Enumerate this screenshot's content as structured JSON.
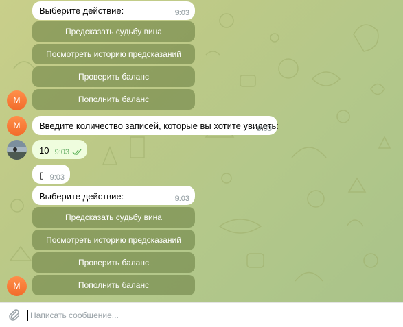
{
  "chat": {
    "background_colors": [
      "#c9cf8a",
      "#a9c38a"
    ],
    "messages": [
      {
        "text": "Выберите действие:",
        "time": "9:03"
      },
      {
        "text": "Введите количество записей, которые вы хотите увидеть:",
        "time": "9:03"
      },
      {
        "text": "10",
        "time": "9:03",
        "status": "read"
      },
      {
        "text": "▯",
        "time": "9:03"
      },
      {
        "text": "Выберите действие:",
        "time": "9:03"
      }
    ],
    "keyboard1": [
      "Предсказать судьбу вина",
      "Посмотреть историю предсказаний",
      "Проверить баланс",
      "Пополнить баланс"
    ],
    "keyboard2": [
      "Предсказать судьбу вина",
      "Посмотреть историю предсказаний",
      "Проверить баланс",
      "Пополнить баланс"
    ],
    "avatar_letter": "M",
    "avatar_color": "#f2782f",
    "read_check_color": "#5fb35a"
  },
  "input": {
    "placeholder": "Написать сообщение...",
    "value": ""
  },
  "icons": {
    "attach": "paperclip-icon",
    "read_status": "double-check-icon"
  }
}
